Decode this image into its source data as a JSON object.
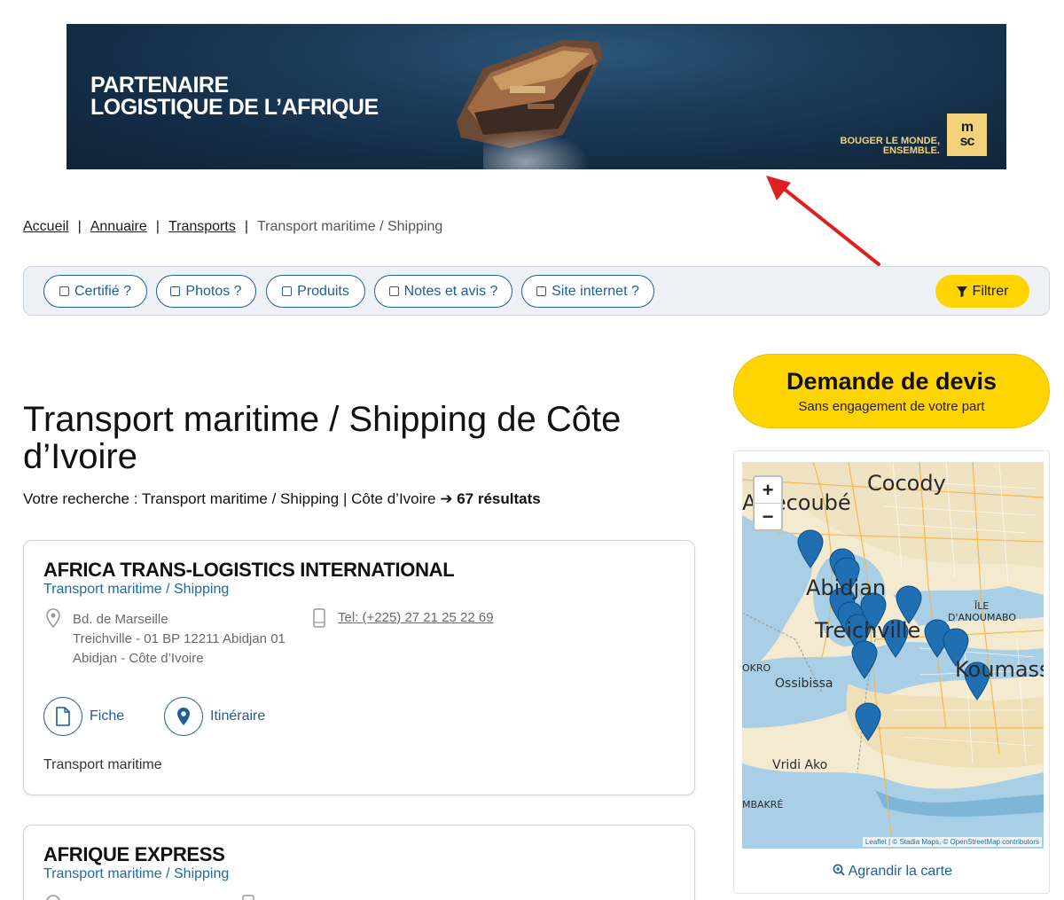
{
  "banner": {
    "line1": "PARTENAIRE",
    "line2": "LOGISTIQUE DE L’AFRIQUE",
    "slogan1": "BOUGER LE MONDE,",
    "slogan2": "ENSEMBLE.",
    "logo_text": "msc"
  },
  "breadcrumb": {
    "items": [
      "Accueil",
      "Annuaire",
      "Transports"
    ],
    "separator": "|",
    "current": "Transport maritime / Shipping"
  },
  "filters": {
    "chips": [
      "Certifié ?",
      "Photos ?",
      "Produits",
      "Notes et avis ?",
      "Site internet ?"
    ],
    "filter_button": "Filtrer"
  },
  "page": {
    "title": "Transport maritime / Shipping de Côte d’Ivoire",
    "search_prefix": "Votre recherche : Transport maritime / Shipping | Côte d’Ivoire ➔ ",
    "result_count": "67 résultats"
  },
  "results": [
    {
      "name": "AFRICA TRANS-LOGISTICS INTERNATIONAL",
      "category": "Transport maritime / Shipping",
      "address_line1": "Bd. de Marseille",
      "address_line2": "Treichville - 01 BP 12211 Abidjan 01",
      "address_line3": "Abidjan - Côte d’Ivoire",
      "phone": "Tel: (+225) 27 21 25 22 69",
      "fiche_label": "Fiche",
      "route_label": "Itinéraire",
      "tag": "Transport maritime"
    },
    {
      "name": "AFRIQUE EXPRESS",
      "category": "Transport maritime / Shipping"
    }
  ],
  "quote": {
    "title": "Demande de devis",
    "subtitle": "Sans engagement de votre part"
  },
  "map": {
    "labels": {
      "cocody": "Cocody",
      "attecoube": "Attécoubé",
      "abidjan": "Abidjan",
      "treichville": "Treichville",
      "ile": "ÎLE",
      "anoumabo": "D'ANOUMABO",
      "koumassi": "Koumassi",
      "okro": "OKRO",
      "ossibissa": "Ossibissa",
      "vridi": "Vridi Ako",
      "mbakre": "MBAKRÉ"
    },
    "zoom_in": "+",
    "zoom_out": "−",
    "attribution_prefix": "Leaflet | © Stadia Maps, © OpenStreetMap contributors",
    "enlarge_label": "Agrandir la carte"
  },
  "colors": {
    "accent_blue": "#1f5d99",
    "accent_yellow": "#ffd400",
    "marker_blue": "#1f6fb2"
  }
}
